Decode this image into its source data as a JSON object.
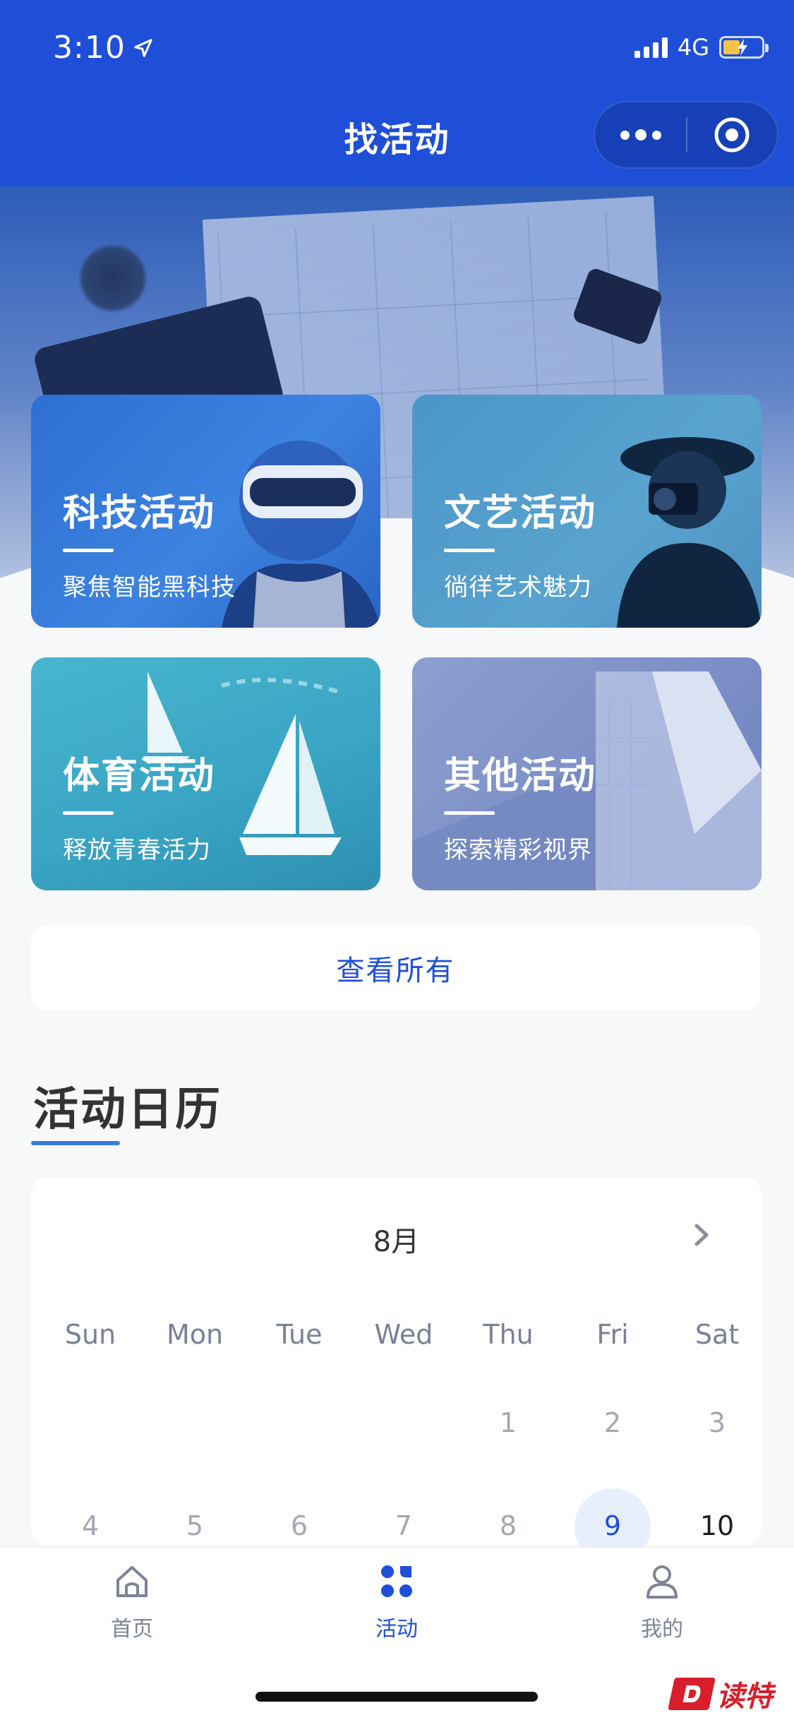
{
  "status_bar": {
    "time": "3:10",
    "network": "4G"
  },
  "header": {
    "title": "找活动"
  },
  "categories": [
    {
      "title": "科技活动",
      "subtitle": "聚焦智能黑科技",
      "icon": "vr-headset-person"
    },
    {
      "title": "文艺活动",
      "subtitle": "徜徉艺术魅力",
      "icon": "photographer"
    },
    {
      "title": "体育活动",
      "subtitle": "释放青春活力",
      "icon": "sailboats"
    },
    {
      "title": "其他活动",
      "subtitle": "探索精彩视界",
      "icon": "modern-building"
    }
  ],
  "view_all": {
    "label": "查看所有"
  },
  "calendar": {
    "section_title": "活动日历",
    "month": "8月",
    "weekdays": [
      "Sun",
      "Mon",
      "Tue",
      "Wed",
      "Thu",
      "Fri",
      "Sat"
    ],
    "rows": [
      [
        "",
        "",
        "",
        "",
        "1",
        "2",
        "3"
      ],
      [
        "4",
        "5",
        "6",
        "7",
        "8",
        "9",
        "10"
      ]
    ],
    "selected_day": "9"
  },
  "tabbar": {
    "items": [
      {
        "label": "首页",
        "icon": "home-icon"
      },
      {
        "label": "活动",
        "icon": "activity-grid-icon"
      },
      {
        "label": "我的",
        "icon": "person-icon"
      }
    ]
  },
  "watermark": {
    "text": "读特"
  },
  "colors": {
    "primary": "#1f4fd8",
    "accent_underline": "#3b7be0",
    "background": "#f7f8fa"
  }
}
